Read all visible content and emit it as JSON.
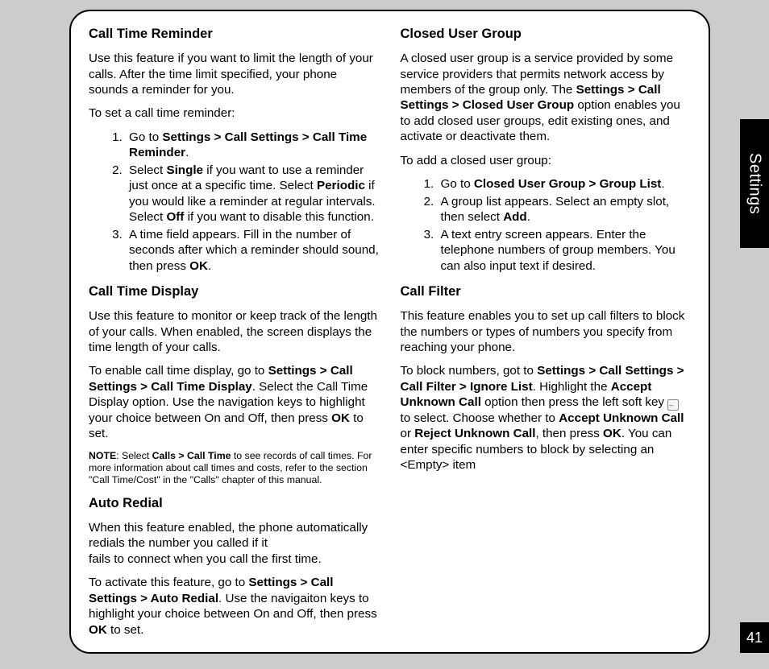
{
  "sideTab": "Settings",
  "pageNumber": "41",
  "leftCol": {
    "h1": "Call Time Reminder",
    "p1": "Use this feature if you want to limit the length of your calls. After the time limit specified, your phone sounds a reminder for you.",
    "p2": "To set a call time reminder:",
    "ol1": {
      "li1a": "Go to ",
      "li1b": "Settings > Call Settings > Call Time Reminder",
      "li1c": ".",
      "li2a": "Select ",
      "li2b": "Single",
      "li2c": " if you want to use a reminder just once at a specific time. Select ",
      "li2d": "Periodic",
      "li2e": " if you would like a reminder at regular intervals. Select ",
      "li2f": "Off",
      "li2g": " if you want to disable this function.",
      "li3a": "A time field appears. Fill in the number of seconds after which a reminder should sound, then press ",
      "li3b": "OK",
      "li3c": "."
    },
    "h2": "Call Time Display",
    "p3": "Use this feature to monitor or keep track of the length of your calls. When enabled, the screen displays the time length of your calls.",
    "p4a": "To enable call time display, go to ",
    "p4b": "Settings > Call Settings > Call Time Display",
    "p4c": ". Select the Call Time Display option. Use the navigation keys to highlight your choice between On and Off, then press ",
    "p4d": "OK",
    "p4e": " to set.",
    "noteA": "NOTE",
    "noteB": ": Select ",
    "noteC": "Calls > Call Time",
    "noteD": " to see records of call times. For more information about call times and costs, refer to the section \"Call Time/Cost\" in the \"Calls\" chapter of this manual.",
    "h3": "Auto Redial",
    "p5": "When this feature enabled, the phone automatically redials the number you called if it "
  },
  "rightCol": {
    "p6": "fails to connect when you call the first time.",
    "p7a": "To activate this feature, go to ",
    "p7b": "Settings > Call Settings > Auto Redial",
    "p7c": ". Use the navigaiton keys to highlight your choice between On and Off, then press ",
    "p7d": "OK",
    "p7e": " to set.",
    "h4": "Closed User Group",
    "p8a": "A closed user group is a service provided by some service providers that permits network access by members of the group only. The ",
    "p8b": "Settings > Call Settings > Closed User Group",
    "p8c": " option enables you to add closed user groups, edit existing ones, and activate or deactivate them.",
    "p9": "To add a closed user group:",
    "ol2": {
      "li1a": "Go to ",
      "li1b": "Closed User Group > Group List",
      "li1c": ".",
      "li2a": "A group list appears. Select an empty slot, then select ",
      "li2b": "Add",
      "li2c": ".",
      "li3": "A text entry screen appears. Enter the telephone numbers of group members. You can also input text if desired."
    },
    "h5": "Call Filter",
    "p10": "This feature enables you to set up call filters to block the numbers or types of numbers you specify from reaching your phone.",
    "p11a": "To block numbers, got to ",
    "p11b": "Settings > Call Settings > Call Filter > Ignore List",
    "p11c": ". Highlight the ",
    "p11d": "Accept Unknown Call",
    "p11e": " option then press the left soft key ",
    "p11f": " to select. Choose whether to ",
    "p11g": "Accept Unknown Call",
    "p11h": " or ",
    "p11i": "Reject Unknown Call",
    "p11j": ", then press ",
    "p11k": "OK",
    "p11l": ". You can enter specific numbers to block by selecting an <Empty> item"
  }
}
